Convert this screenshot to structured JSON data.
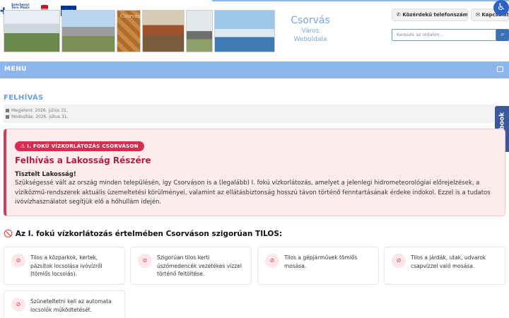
{
  "header": {
    "logos": {
      "szechenyi": "Széchenyi Terv Plusz",
      "szechenyi_sub": "Nemzeti Fejlesztési Ügynökség",
      "gov": "Magyarország Kormánya",
      "eu": "Európai Unió"
    },
    "banner_badge": "Csorvás",
    "site_title": "Csorvás",
    "site_sub1": "Város",
    "site_sub2": "Weboldala",
    "phones_label": "Közérdekű telefonszámok",
    "contact_label": "Kapcsolat",
    "search_placeholder": "Keresés az oldalon..."
  },
  "menu": {
    "label": "MENU"
  },
  "article": {
    "title": "FELHÍVÁS",
    "published": "Megjelent: 2026. július 31.",
    "modified": "Módosítás: 2026. július 31."
  },
  "alert": {
    "pill": "⚠ I. FOKÚ VÍZKORLÁTOZÁS CSORVÁSON",
    "heading": "Felhívás a Lakosság Részére",
    "greeting": "Tisztelt Lakosság!",
    "body": "Szükségessé vált az ország minden településén, így Csorváson is a (legalább) I. fokú vízkorlátozás, amelyet a jelenlegi hidrometeorológiai előrejelzések, a víziközmű-rendszerek aktuális üzemeltetési körülményei, valamint az ellátásbiztonság hosszú távon történő fenntartásának érdeke indokol. Ezzel is a tudatos ivóvízhasználatot segítjük elő a hőhullám idején."
  },
  "tilos": {
    "heading": "🚫 Az I. fokú vízkorlátozás értelmében Csorváson szigorúan TILOS:",
    "items": [
      "Tilos a közparkok, kertek, pázsitok locsolása ivóvízről (tömlős locsolás).",
      "Szigorúan tilos kerti úszómedencék vezetékes vízzel történő feltöltése.",
      "Tilos a gépjárművek tömlős mosása.",
      "Tilos a járdák, utak, udvarok csapvízzel való mosása.",
      "Szüneteltetni kell az automata locsolók működtetését."
    ]
  },
  "social": {
    "facebook": "facebook"
  },
  "icons": {
    "accessibility": "accessibility-icon",
    "phone": "phone-icon",
    "contact": "mail-icon",
    "search": "search-icon",
    "menu_toggle": "screen-icon",
    "calendar": "calendar-icon",
    "forbidden": "forbidden-icon"
  },
  "colors": {
    "accent_blue": "#8cb6ec",
    "title_blue": "#6aa0e2",
    "alert_red": "#d92d4f",
    "alert_bg": "#fdecee",
    "facebook": "#3b5998"
  }
}
